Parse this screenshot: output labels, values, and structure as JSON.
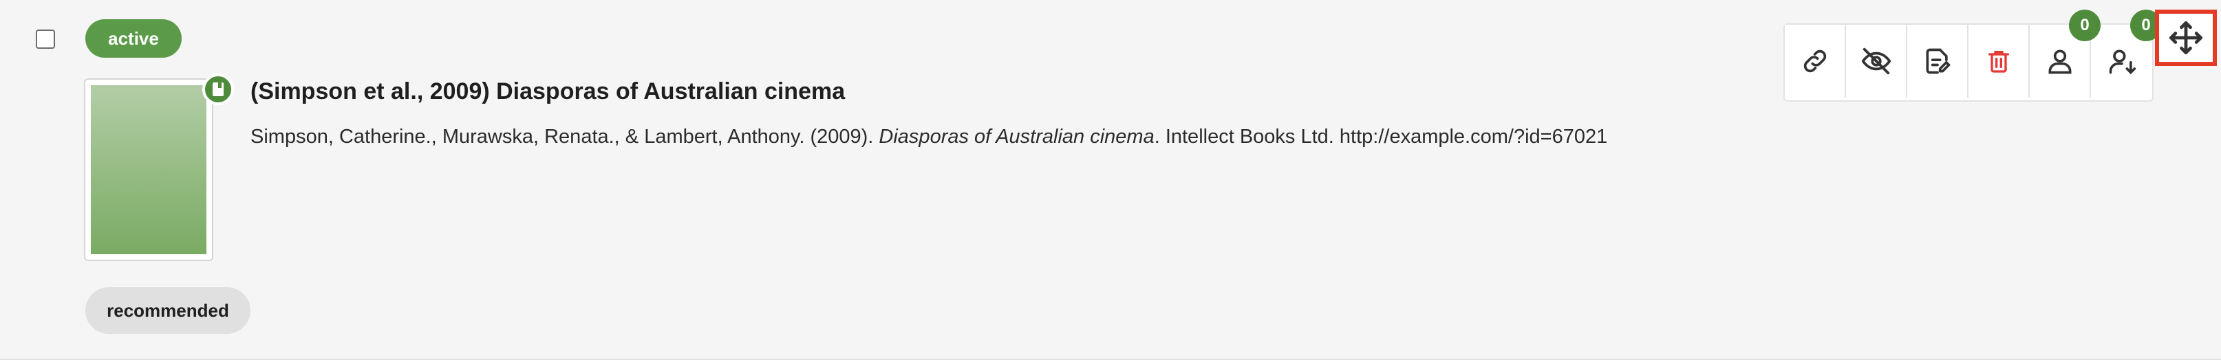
{
  "item": {
    "status": "active",
    "title": "(Simpson et al., 2009) Diasporas of Australian cinema",
    "citation": {
      "authors_year": "Simpson, Catherine., Murawska, Renata., & Lambert, Anthony. (2009).",
      "work_title": "Diasporas of Australian cinema",
      "publisher_url": ". Intellect Books Ltd. http://example.com/?id=67021"
    },
    "tag": "recommended"
  },
  "toolbar": {
    "buttons": [
      {
        "icon": "link-icon"
      },
      {
        "icon": "eye-off-icon"
      },
      {
        "icon": "edit-document-icon"
      },
      {
        "icon": "trash-icon",
        "color": "#e53935"
      },
      {
        "icon": "person-icon",
        "count": "0"
      },
      {
        "icon": "person-download-icon",
        "count": "0"
      },
      {
        "icon": "move-icon",
        "highlight": "#e53a26"
      }
    ]
  },
  "colors": {
    "accent_green": "#5a9a48",
    "delete_red": "#e53935"
  }
}
